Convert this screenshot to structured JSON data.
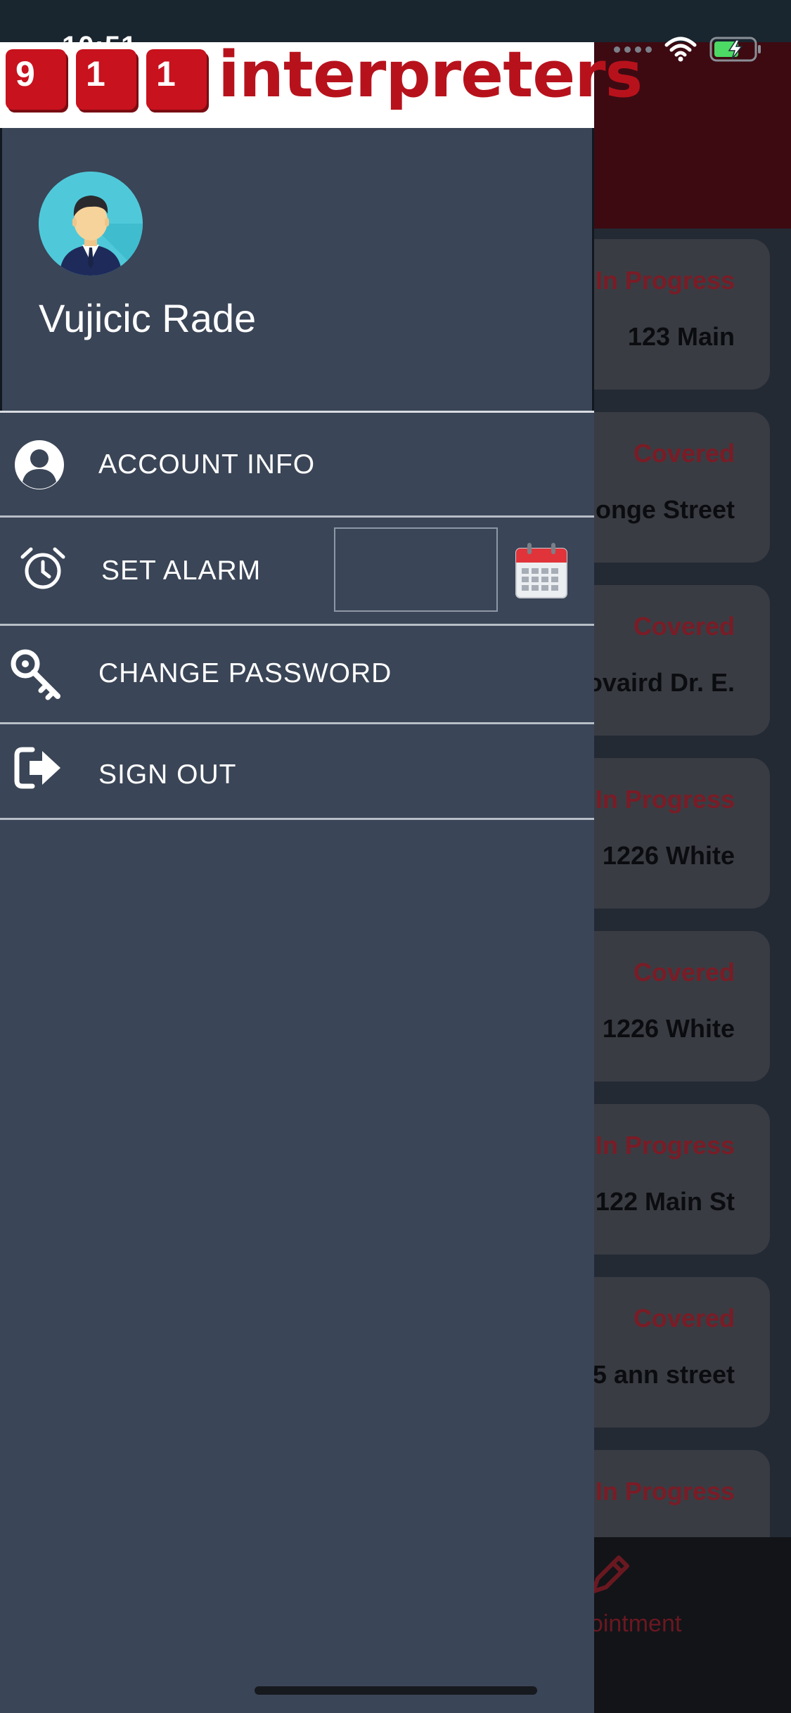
{
  "status_bar": {
    "time": "10:51"
  },
  "logo": {
    "keys": [
      "9",
      "1",
      "1"
    ],
    "word": "interpreters"
  },
  "profile": {
    "user_name": "Vujicic Rade"
  },
  "menu": {
    "account_info": "ACCOUNT INFO",
    "set_alarm": "SET ALARM",
    "change_password": "CHANGE PASSWORD",
    "sign_out": "SIGN OUT"
  },
  "alarm": {
    "value": ""
  },
  "background_list": {
    "cards": [
      {
        "status": "In Progress",
        "address": "123 Main"
      },
      {
        "status": "Covered",
        "address": "onge Street"
      },
      {
        "status": "Covered",
        "address": "ovaird Dr. E."
      },
      {
        "status": "In Progress",
        "address": "1226 White"
      },
      {
        "status": "Covered",
        "address": "1226 White"
      },
      {
        "status": "In Progress",
        "address": "122 Main St"
      },
      {
        "status": "Covered",
        "address": "5 ann street"
      },
      {
        "status": "In Progress",
        "address": ""
      }
    ],
    "tab_label": "pointment"
  },
  "colors": {
    "drawer_bg": "#3a4557",
    "brand_red": "#c8121e",
    "status_red": "#7a1c26"
  }
}
